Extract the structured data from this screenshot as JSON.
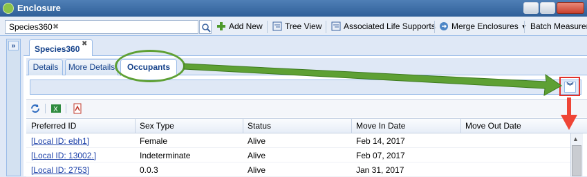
{
  "window": {
    "title": "Enclosure"
  },
  "toolbar": {
    "search_tag": "Species360",
    "add_new": "Add New",
    "tree_view": "Tree View",
    "associated_life_supports": "Associated Life Supports",
    "merge_enclosures": "Merge Enclosures",
    "batch_measure": "Batch Measuren"
  },
  "tabs": {
    "outer": "Species360",
    "inner": [
      "Details",
      "More Details",
      "Occupants"
    ],
    "active_inner": "Occupants"
  },
  "grid": {
    "columns": [
      "Preferred ID",
      "Sex Type",
      "Status",
      "Move In Date",
      "Move Out Date"
    ],
    "rows": [
      {
        "id": "[Local ID: ebh1]",
        "sex": "Female",
        "status": "Alive",
        "move_in": "Feb 14, 2017",
        "move_out": ""
      },
      {
        "id": "[Local ID: 13002.]",
        "sex": "Indeterminate",
        "status": "Alive",
        "move_in": "Feb 07, 2017",
        "move_out": ""
      },
      {
        "id": "[Local ID: 2753]",
        "sex": "0.0.3",
        "status": "Alive",
        "move_in": "Jan 31, 2017",
        "move_out": ""
      }
    ]
  },
  "icons": {
    "title": "enclosure-icon",
    "search": "magnifier-icon",
    "add": "plus-icon",
    "tree": "tree-icon",
    "life_support": "tree-icon",
    "merge": "merge-icon",
    "refresh": "refresh-icon",
    "excel": "excel-icon",
    "pdf": "pdf-icon",
    "expand": "double-chevron-right-icon",
    "collapse": "double-chevron-down-icon"
  },
  "colors": {
    "annotation_green": "#5ea034",
    "annotation_red": "#e2312a",
    "link": "#1a3fa8"
  }
}
